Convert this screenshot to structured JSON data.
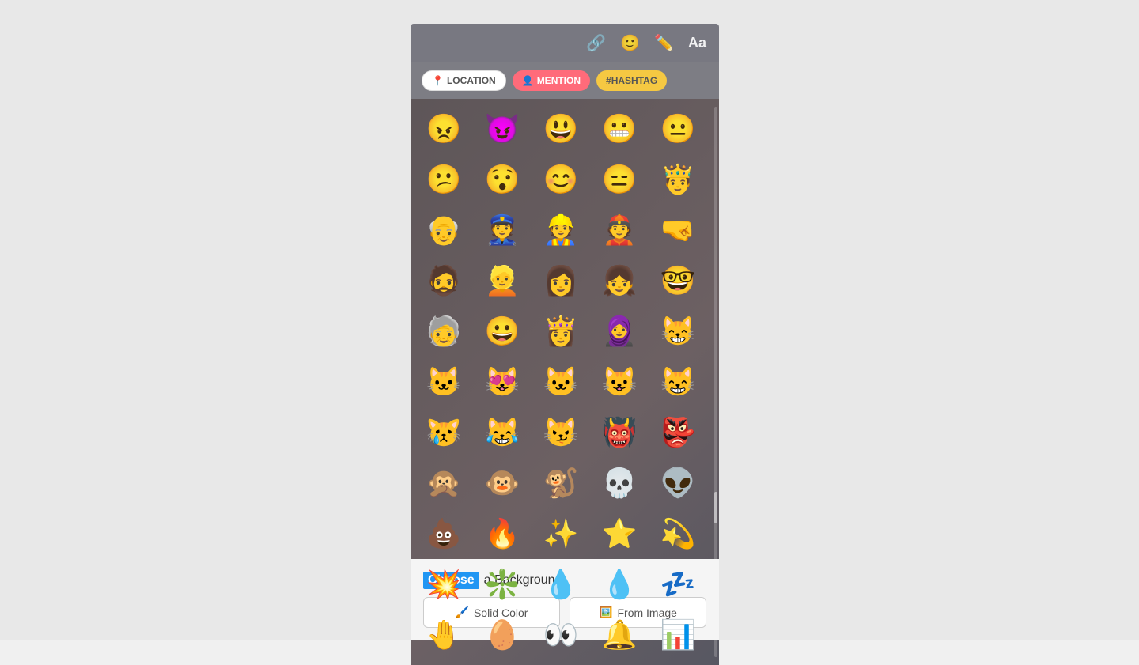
{
  "toolbar": {
    "icons": [
      {
        "name": "link-icon",
        "symbol": "🔗"
      },
      {
        "name": "emoji-icon",
        "symbol": "🙂"
      },
      {
        "name": "brush-icon",
        "symbol": "✏️"
      },
      {
        "name": "text-icon",
        "symbol": "Aa"
      }
    ]
  },
  "tags": [
    {
      "id": "location",
      "label": "LOCATION",
      "icon": "📍",
      "class": "tag-location"
    },
    {
      "id": "mention",
      "label": "MENTION",
      "icon": "👤",
      "class": "tag-mention"
    },
    {
      "id": "hashtag",
      "label": "#HASHTAG",
      "icon": "",
      "class": "tag-hashtag"
    }
  ],
  "emojis": [
    "😠",
    "😈",
    "😃",
    "😬",
    "😐",
    "😕",
    "😯",
    "😊",
    "😑",
    "🤴",
    "👴",
    "👮",
    "👷",
    "👲",
    "🤜",
    "🧔",
    "👱",
    "👩",
    "👧",
    "🤓",
    "🧓",
    "😀",
    "👸",
    "🧕",
    "😸",
    "🐱",
    "😻",
    "🐱",
    "😺",
    "😸",
    "😿",
    "😹",
    "😼",
    "👹",
    "👺",
    "🙊",
    "🐵",
    "🐒",
    "💀",
    "👽",
    "💩",
    "🔥",
    "✨",
    "⭐",
    "💫",
    "💥",
    "❇️",
    "💧",
    "💧",
    "💤",
    "🤚",
    "🥚",
    "👀",
    "🔔",
    "📊"
  ],
  "bottom": {
    "choose_label": "Choose",
    "bg_text": "a Background:",
    "solid_color_label": "Solid Color",
    "from_image_label": "From Image"
  }
}
